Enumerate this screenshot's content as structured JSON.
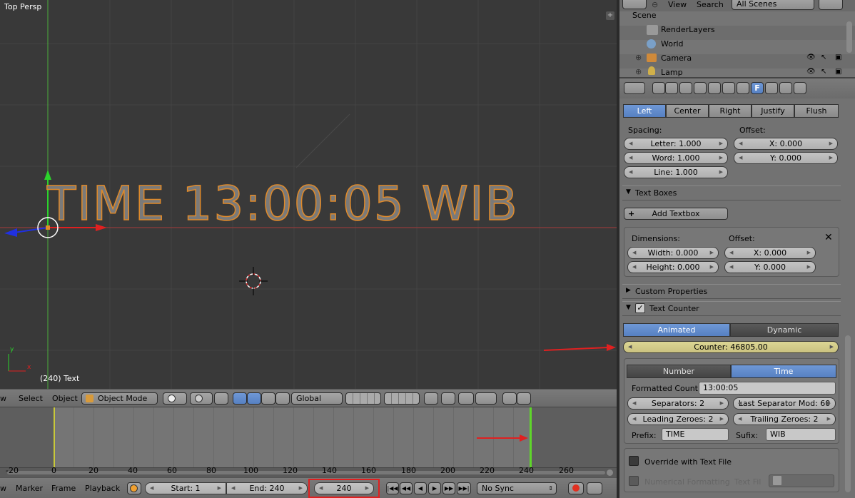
{
  "viewport": {
    "title": "Top Persp",
    "status": "(240) Text",
    "text_object": "TIME 13:00:05 WIB",
    "axis_y": "y",
    "axis_x": "x"
  },
  "view_header": {
    "menu_view": "w",
    "menu_select": "Select",
    "menu_object": "Object",
    "mode": "Object Mode",
    "orientation": "Global"
  },
  "timeline": {
    "ticks": [
      "-20",
      "0",
      "20",
      "40",
      "60",
      "80",
      "100",
      "120",
      "140",
      "160",
      "180",
      "200",
      "220",
      "240",
      "260"
    ],
    "menu_marker": "Marker",
    "menu_frame": "Frame",
    "menu_playback": "Playback",
    "start": "Start: 1",
    "end": "End: 240",
    "current": "240",
    "sync": "No Sync"
  },
  "outliner": {
    "menu_view": "View",
    "menu_search": "Search",
    "scene_select": "All Scenes",
    "items": [
      {
        "label": "Scene"
      },
      {
        "label": "RenderLayers"
      },
      {
        "label": "World"
      },
      {
        "label": "Camera"
      },
      {
        "label": "Lamp"
      }
    ]
  },
  "properties": {
    "align": [
      "Left",
      "Center",
      "Right",
      "Justify",
      "Flush"
    ],
    "align_active": "Left",
    "spacing_label": "Spacing:",
    "letter": "Letter: 1.000",
    "word": "Word: 1.000",
    "line": "Line: 1.000",
    "offset_label": "Offset:",
    "offset_x": "X: 0.000",
    "offset_y": "Y: 0.000",
    "text_boxes_title": "Text Boxes",
    "add_textbox": "Add Textbox",
    "dimensions_label": "Dimensions:",
    "tb_offset_label": "Offset:",
    "width": "Width: 0.000",
    "height": "Height: 0.000",
    "tb_x": "X: 0.000",
    "tb_y": "Y: 0.000",
    "custom_props_title": "Custom Properties",
    "text_counter_title": "Text Counter",
    "counter_mode": [
      "Animated",
      "Dynamic"
    ],
    "counter": "Counter: 46805.00",
    "format_mode": [
      "Number",
      "Time"
    ],
    "formatted_count_label": "Formatted Count",
    "formatted_count": "13:00:05",
    "separators": "Separators: 2",
    "last_sep_mod": "Last Separator Mod: 60",
    "leading_zeroes": "Leading Zeroes: 2",
    "trailing_zeroes": "Trailing Zeroes: 2",
    "prefix_label": "Prefix:",
    "prefix": "TIME",
    "sufix_label": "Sufix:",
    "sufix": "WIB",
    "override_label": "Override with Text File",
    "numerical_label": "Numerical Formatting",
    "text_file_label": "Text Fil"
  },
  "colors": {
    "accent": "#5680c2",
    "counter_bg": "#d6d18a",
    "arrow": "#e02020"
  }
}
